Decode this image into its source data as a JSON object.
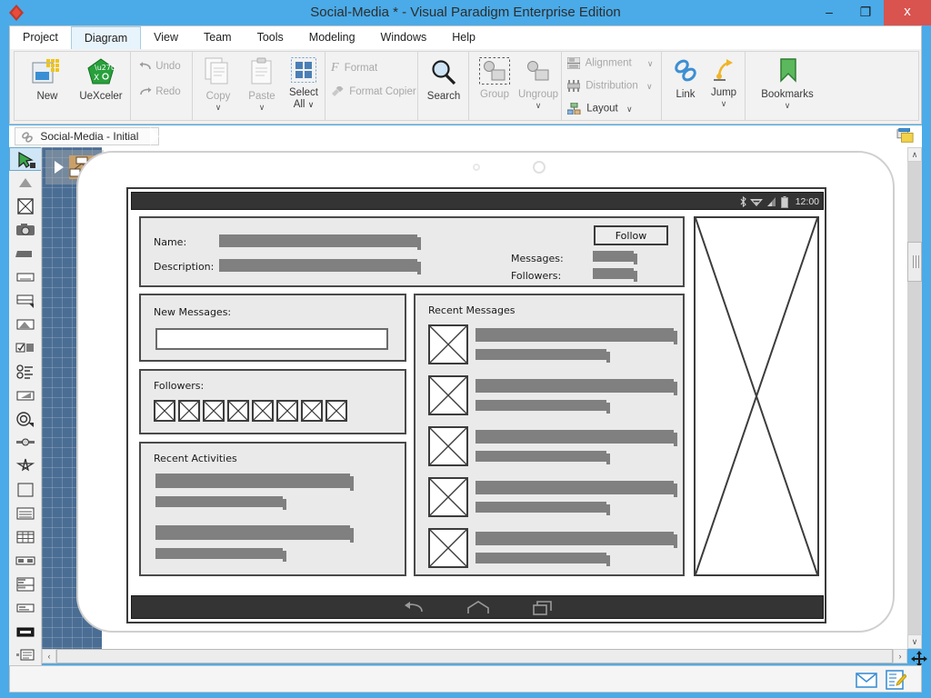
{
  "window": {
    "title": "Social-Media * - Visual Paradigm Enterprise Edition",
    "minimize": "–",
    "maximize": "❐",
    "close": "x",
    "logo_icon": "visual-paradigm-logo"
  },
  "menu": {
    "items": [
      {
        "label": "Project",
        "active": false
      },
      {
        "label": "Diagram",
        "active": true
      },
      {
        "label": "View",
        "active": false
      },
      {
        "label": "Team",
        "active": false
      },
      {
        "label": "Tools",
        "active": false
      },
      {
        "label": "Modeling",
        "active": false
      },
      {
        "label": "Windows",
        "active": false
      },
      {
        "label": "Help",
        "active": false
      }
    ]
  },
  "ribbon": {
    "new": {
      "label": "New",
      "icon": "new-diagram-icon"
    },
    "uexceler": {
      "label": "UeXceler",
      "icon": "uexceler-icon"
    },
    "undo": {
      "label": "Undo",
      "icon": "undo-arrow-icon"
    },
    "redo": {
      "label": "Redo",
      "icon": "redo-arrow-icon"
    },
    "copy": {
      "label": "Copy",
      "icon": "copy-icon",
      "chevron": "∨"
    },
    "paste": {
      "label": "Paste",
      "icon": "paste-icon",
      "chevron": "∨"
    },
    "select_all": {
      "label": "Select",
      "label2": "All",
      "icon": "select-all-icon",
      "chevron": "∨"
    },
    "format": {
      "label": "Format",
      "icon": "format-f-icon"
    },
    "format_copier": {
      "label": "Format Copier",
      "icon": "format-copier-brush-icon"
    },
    "search": {
      "label": "Search",
      "icon": "search-magnifier-icon"
    },
    "group": {
      "label": "Group",
      "icon": "group-icon"
    },
    "ungroup": {
      "label": "Ungroup",
      "icon": "ungroup-icon",
      "chevron": "∨"
    },
    "alignment": {
      "label": "Alignment",
      "icon": "alignment-icon",
      "chevron": "∨"
    },
    "distribution": {
      "label": "Distribution",
      "icon": "distribution-icon",
      "chevron": "∨"
    },
    "layout": {
      "label": "Layout",
      "icon": "layout-icon",
      "chevron": "∨"
    },
    "link": {
      "label": "Link",
      "icon": "link-chain-icon"
    },
    "jump": {
      "label": "Jump",
      "icon": "jump-arrow-icon",
      "chevron": "∨"
    },
    "bookmarks": {
      "label": "Bookmarks",
      "icon": "bookmark-icon",
      "chevron": "∨"
    }
  },
  "breadcrumb": {
    "label": "Social-Media - Initial",
    "icon": "chain-link-icon",
    "tree_icon": "diagram-navigator-icon"
  },
  "palette": {
    "items": [
      {
        "name": "pointer-tool",
        "icon": "pointer-icon",
        "selected": true
      },
      {
        "name": "marquee-tool",
        "icon": "triangle-up-icon",
        "selected": false
      },
      {
        "name": "image-tool",
        "icon": "image-placeholder-icon",
        "selected": false
      },
      {
        "name": "camera-tool",
        "icon": "camera-icon",
        "selected": false
      },
      {
        "name": "bar-tool",
        "icon": "filled-bar-icon",
        "selected": false
      },
      {
        "name": "text-field-tool",
        "icon": "text-field-icon",
        "selected": false
      },
      {
        "name": "panel-tool",
        "icon": "panel-icon",
        "selected": false
      },
      {
        "name": "shape-tool",
        "icon": "corner-shape-icon",
        "selected": false
      },
      {
        "name": "checkbox-tool",
        "icon": "checkbox-icon",
        "selected": false
      },
      {
        "name": "radio-list-tool",
        "icon": "radio-list-icon",
        "selected": false
      },
      {
        "name": "slider-tool",
        "icon": "slider-icon",
        "selected": false
      },
      {
        "name": "spinner-tool",
        "icon": "spinner-icon",
        "selected": false
      },
      {
        "name": "toggle-tool",
        "icon": "toggle-switch-icon",
        "selected": false
      },
      {
        "name": "star-tool",
        "icon": "star-icon",
        "selected": false
      },
      {
        "name": "rectangle-tool",
        "icon": "rectangle-icon",
        "selected": false
      },
      {
        "name": "list-tool",
        "icon": "list-lines-icon",
        "selected": false
      },
      {
        "name": "table-tool",
        "icon": "table-grid-icon",
        "selected": false
      },
      {
        "name": "split-tool",
        "icon": "split-panes-icon",
        "selected": false
      },
      {
        "name": "layout-tool",
        "icon": "layout-blocks-icon",
        "selected": false
      },
      {
        "name": "label-tool",
        "icon": "label-icon",
        "selected": false
      },
      {
        "name": "button-tool",
        "icon": "button-filled-icon",
        "selected": false
      },
      {
        "name": "tree-tool",
        "icon": "tree-indent-icon",
        "selected": false
      },
      {
        "name": "dropdown-tool",
        "icon": "dropdown-icon",
        "selected": false
      }
    ],
    "more": "▼"
  },
  "canvas": {
    "selected_node": {
      "name": "social-media-initial-node",
      "arrow": "▶",
      "icon": "wireframe-thumbnail-icon"
    }
  },
  "wireframe": {
    "status_bar": {
      "time": "12:00",
      "icons": [
        "bluetooth-icon",
        "wifi-icon",
        "signal-icon",
        "battery-icon"
      ]
    },
    "nav_bar": {
      "icons": [
        "back-icon",
        "home-icon",
        "recents-icon"
      ]
    },
    "profile": {
      "name_label": "Name:",
      "description_label": "Description:",
      "follow_button": "Follow",
      "messages_label": "Messages:",
      "followers_label": "Followers:"
    },
    "new_messages": {
      "label": "New Messages:",
      "value": "",
      "placeholder": ""
    },
    "followers": {
      "label": "Followers:",
      "count": 8
    },
    "recent_activities": {
      "label": "Recent Activities",
      "groups": 2
    },
    "recent_messages": {
      "label": "Recent Messages",
      "items": 5
    },
    "profile_image": {
      "name": "profile-image-placeholder"
    }
  },
  "scrollbars": {
    "up": "∧",
    "down": "∨",
    "left": "‹",
    "right": "›",
    "pan_icon": "pan-move-icon"
  },
  "bottom": {
    "mail_icon": "message-envelope-icon",
    "note_icon": "note-edit-icon"
  },
  "colors": {
    "titlebar": "#4aabe8",
    "close": "#d9534f",
    "accent": "#1e7bbf",
    "grid": "#4a6d94",
    "wire_gray": "#808080",
    "panel_bg": "#eaeaea"
  }
}
